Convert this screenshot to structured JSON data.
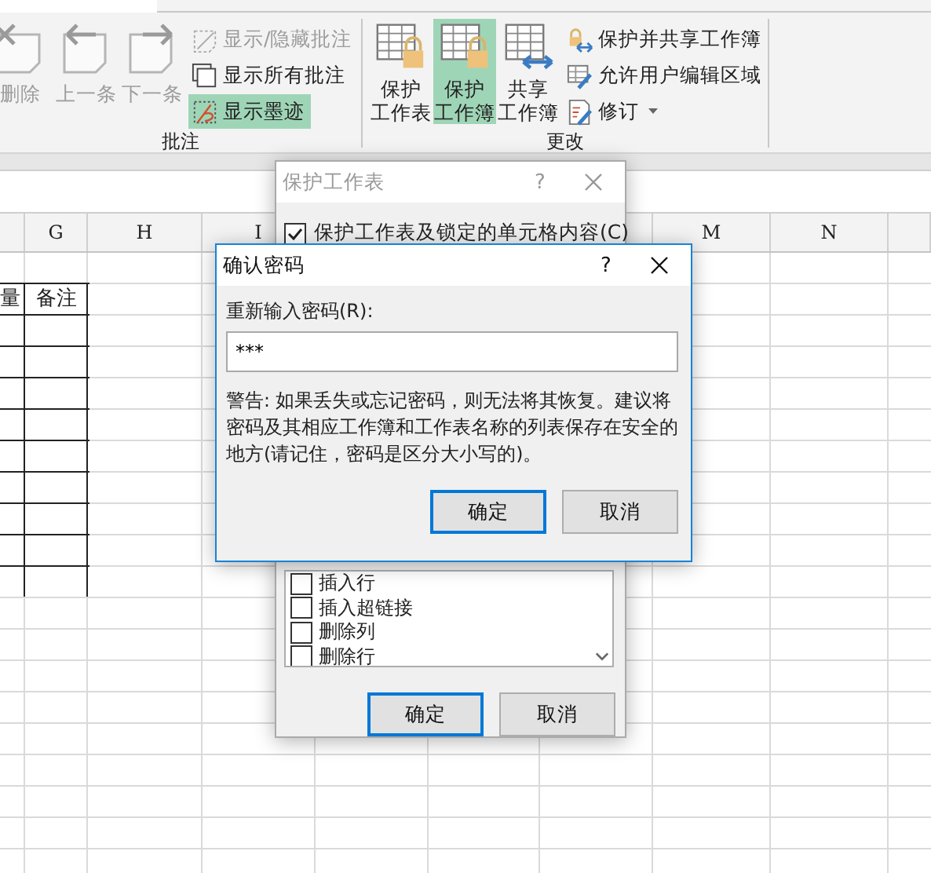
{
  "ribbon": {
    "groups": [
      {
        "label": "批注",
        "large_buttons": [
          {
            "kind": "delete",
            "lines": [
              "删除"
            ],
            "disabled": true,
            "selected": false
          },
          {
            "kind": "prev",
            "lines": [
              "上一条"
            ],
            "disabled": true,
            "selected": false
          },
          {
            "kind": "next",
            "lines": [
              "下一条"
            ],
            "disabled": true,
            "selected": false
          }
        ],
        "small_buttons": [
          {
            "kind": "showhide",
            "label": "显示/隐藏批注",
            "disabled": true,
            "selected": false,
            "dropdown": false
          },
          {
            "kind": "showall",
            "label": "显示所有批注",
            "disabled": false,
            "selected": false,
            "dropdown": false
          },
          {
            "kind": "ink",
            "label": "显示墨迹",
            "disabled": false,
            "selected": true,
            "dropdown": false
          }
        ]
      },
      {
        "label": "更改",
        "large_buttons": [
          {
            "kind": "protect-sheet",
            "lines": [
              "保护",
              "工作表"
            ],
            "disabled": false,
            "selected": false
          },
          {
            "kind": "protect-book",
            "lines": [
              "保护",
              "工作簿"
            ],
            "disabled": false,
            "selected": true
          },
          {
            "kind": "share",
            "lines": [
              "共享",
              "工作簿"
            ],
            "disabled": false,
            "selected": false
          }
        ],
        "small_buttons": [
          {
            "kind": "protect-share",
            "label": "保护并共享工作簿",
            "disabled": false,
            "selected": false,
            "dropdown": false
          },
          {
            "kind": "allow-edit",
            "label": "允许用户编辑区域",
            "disabled": false,
            "selected": false,
            "dropdown": false
          },
          {
            "kind": "track",
            "label": "修订",
            "disabled": false,
            "selected": false,
            "dropdown": true
          }
        ]
      }
    ]
  },
  "sheet": {
    "columns": [
      {
        "label": "G"
      },
      {
        "label": "H"
      },
      {
        "label": "I"
      },
      {
        "label": "M"
      },
      {
        "label": "N"
      }
    ],
    "table_header": [
      "量",
      "备注"
    ]
  },
  "protect_sheet_dialog": {
    "title": "保护工作表",
    "active": false,
    "help": "?",
    "main_option": {
      "label": "保护工作表及锁定的单元格内容(C)",
      "checked": true
    },
    "permissions": [
      {
        "label": "插入行",
        "checked": false
      },
      {
        "label": "插入超链接",
        "checked": false
      },
      {
        "label": "删除列",
        "checked": false
      },
      {
        "label": "删除行",
        "checked": false
      }
    ],
    "buttons": [
      {
        "label": "确定",
        "default": true
      },
      {
        "label": "取消",
        "default": false
      }
    ]
  },
  "confirm_dialog": {
    "title": "确认密码",
    "active": true,
    "help": "?",
    "field_label": "重新输入密码(R):",
    "password": "***",
    "warning": "警告: 如果丢失或忘记密码，则无法将其恢复。建议将密码及其相应工作簿和工作表名称的列表保存在安全的地方(请记住，密码是区分大小写的)。",
    "buttons": [
      {
        "label": "确定",
        "default": true
      },
      {
        "label": "取消",
        "default": false
      }
    ]
  }
}
